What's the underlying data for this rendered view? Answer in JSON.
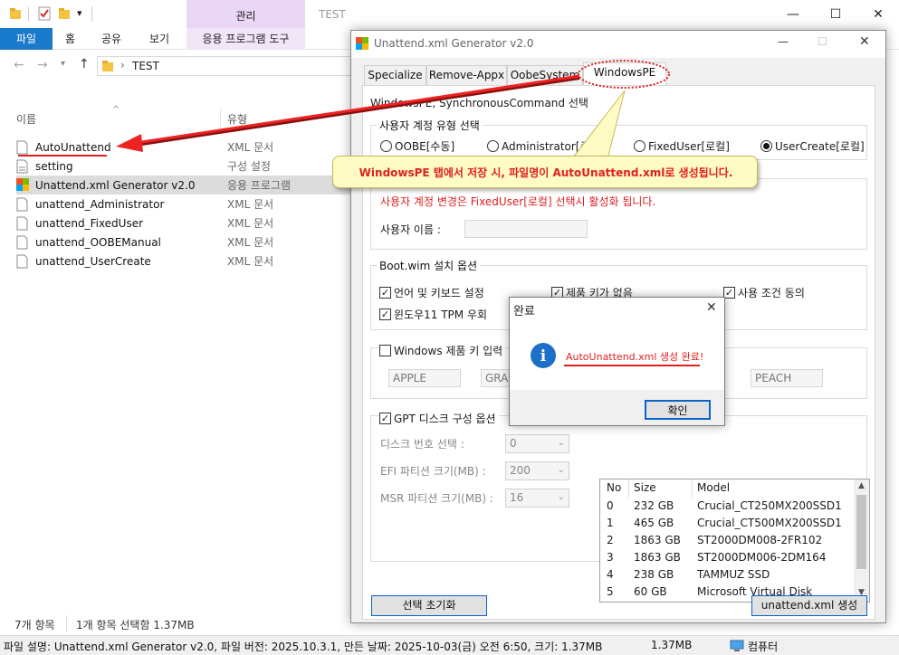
{
  "explorer": {
    "quick_access_dropdown": "▾",
    "manage_label": "관리",
    "window_title": "TEST",
    "ribbon_tabs": [
      "파일",
      "홈",
      "공유",
      "보기",
      "응용 프로그램 도구"
    ],
    "address": "TEST",
    "columns": {
      "name": "이름",
      "type": "유형"
    },
    "files": [
      {
        "name": "AutoUnattend",
        "type": "XML 문서",
        "icon": "xml-file-icon"
      },
      {
        "name": "setting",
        "type": "구성 설정",
        "icon": "settings-file-icon"
      },
      {
        "name": "Unattend.xml Generator v2.0",
        "type": "응용 프로그램",
        "icon": "app-icon"
      },
      {
        "name": "unattend_Administrator",
        "type": "XML 문서",
        "icon": "xml-file-icon"
      },
      {
        "name": "unattend_FixedUser",
        "type": "XML 문서",
        "icon": "xml-file-icon"
      },
      {
        "name": "unattend_OOBEManual",
        "type": "XML 문서",
        "icon": "xml-file-icon"
      },
      {
        "name": "unattend_UserCreate",
        "type": "XML 문서",
        "icon": "xml-file-icon"
      }
    ],
    "status": {
      "count": "7개 항목",
      "selected": "1개 항목 선택함 1.37MB"
    },
    "infobar": {
      "description": "파일 설명: Unattend.xml Generator v2.0, 파일 버전: 2025.10.3.1, 만든 날짜: 2025-10-03(금) 오전 6:50, 크기: 1.37MB",
      "size": "1.37MB",
      "location": "컴퓨터"
    }
  },
  "generator": {
    "title": "Unattend.xml Generator v2.0",
    "tabs": [
      "Specialize",
      "Remove-Appx",
      "OobeSystem",
      "WindowsPE"
    ],
    "active_tab": "WindowsPE",
    "sync_heading": "WindowsPE, SynchronousCommand 선택",
    "account_type_group": "사용자 계정 유형 선택",
    "account_types": [
      {
        "label": "OOBE[수동]",
        "selected": false
      },
      {
        "label": "Administrator[로컬]",
        "selected": false
      },
      {
        "label": "FixedUser[로컬]",
        "selected": false
      },
      {
        "label": "UserCreate[로컬]",
        "selected": true
      }
    ],
    "account_change_note": "사용자 계정 변경은 FixedUser[로컬] 선택시 활성화 됩니다.",
    "username_label": "사용자 이름 :",
    "username_value": "",
    "bootwim_group": "Boot.wim 설치 옵션",
    "bootwim_options": [
      {
        "label": "언어 및 키보드 설정",
        "checked": true
      },
      {
        "label": "제품 키가 없음",
        "checked": true
      },
      {
        "label": "사용 조건 동의",
        "checked": true
      },
      {
        "label": "윈도우11 TPM 우회",
        "checked": true
      }
    ],
    "product_key_label": "Windows 제품 키 입력",
    "product_key_checked": false,
    "product_keys": [
      "APPLE",
      "GRAP",
      "PEACH"
    ],
    "gpt_label": "GPT 디스크 구성 옵션",
    "gpt_checked": true,
    "disk_number_label": "디스크 번호 선택 :",
    "disk_number_value": "0",
    "efi_label": "EFI 파티션 크기(MB) :",
    "efi_value": "200",
    "msr_label": "MSR 파티션 크기(MB) :",
    "msr_value": "16",
    "disk_table": {
      "headers": [
        "No",
        "Size",
        "Model"
      ],
      "rows": [
        [
          "0",
          "232 GB",
          "Crucial_CT250MX200SSD1"
        ],
        [
          "1",
          "465 GB",
          "Crucial_CT500MX200SSD1"
        ],
        [
          "2",
          "1863 GB",
          "ST2000DM008-2FR102"
        ],
        [
          "3",
          "1863 GB",
          "ST2000DM006-2DM164"
        ],
        [
          "4",
          "238 GB",
          "TAMMUZ SSD"
        ],
        [
          "5",
          "60 GB",
          "Microsoft Virtual Disk"
        ]
      ]
    },
    "reset_button": "선택 초기화",
    "generate_button": "unattend.xml 생성"
  },
  "callout": "WindowsPE 탭에서 저장 시, 파일명이 AutoUnattend.xml로 생성됩니다.",
  "message_box": {
    "title": "완료",
    "message": "AutoUnattend.xml 생성 완료!",
    "ok_button": "확인"
  },
  "colors": {
    "accent": "#1979ca",
    "annotation_red": "#e02020",
    "callout_bg": "#fffbc4",
    "manage_tab": "#e9d7f5"
  }
}
